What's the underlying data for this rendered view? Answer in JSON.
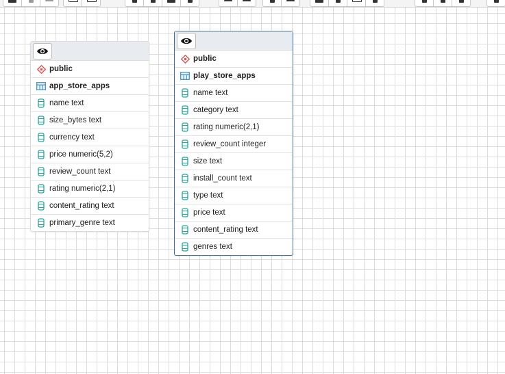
{
  "tables": [
    {
      "schema": "public",
      "name": "app_store_apps",
      "columns": [
        "name text",
        "size_bytes text",
        "currency text",
        "price numeric(5,2)",
        "review_count text",
        "rating numeric(2,1)",
        "content_rating text",
        "primary_genre text"
      ]
    },
    {
      "schema": "public",
      "name": "play_store_apps",
      "columns": [
        "name text",
        "category text",
        "rating numeric(2,1)",
        "review_count integer",
        "size text",
        "install_count text",
        "type text",
        "price text",
        "content_rating text",
        "genres text"
      ]
    }
  ],
  "icons": {
    "toggle": "eye-icon",
    "schema": "schema-diamond-icon",
    "table": "table-grid-icon",
    "column": "column-cylinder-icon"
  },
  "colors": {
    "schema_icon": "#d9534f",
    "table_icon": "#3c8dbc",
    "column_icon": "#26a69a",
    "selected_border": "#3f6e9a",
    "header_bg": "#e8ebf0"
  }
}
